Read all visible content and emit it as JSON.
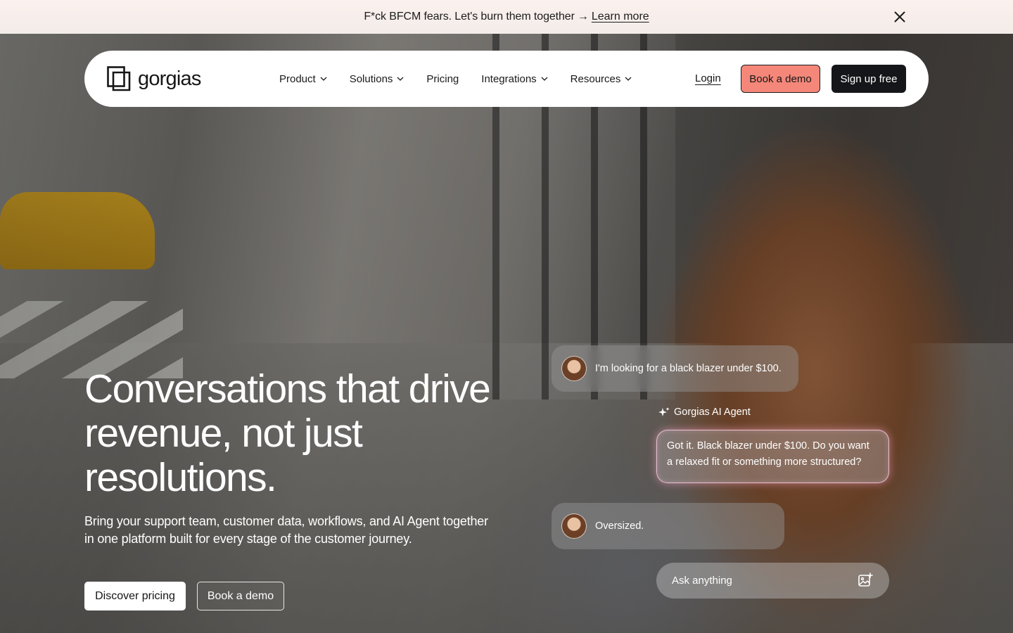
{
  "announcement": {
    "text": "F*ck BFCM fears. Let's burn them together",
    "arrow": "→",
    "link_label": "Learn more"
  },
  "nav": {
    "logo_text": "gorgias",
    "items": [
      {
        "label": "Product",
        "has_dropdown": true
      },
      {
        "label": "Solutions",
        "has_dropdown": true
      },
      {
        "label": "Pricing",
        "has_dropdown": false
      },
      {
        "label": "Integrations",
        "has_dropdown": true
      },
      {
        "label": "Resources",
        "has_dropdown": true
      }
    ],
    "login_label": "Login",
    "book_demo_label": "Book a demo",
    "signup_label": "Sign up free"
  },
  "hero": {
    "title": "Conversations that drive revenue, not just resolutions.",
    "subtitle": "Bring your support team, customer data, workflows, and AI Agent together in one platform built for every stage of the customer journey.",
    "primary_cta": "Discover pricing",
    "secondary_cta": "Book a demo"
  },
  "chat": {
    "user_message_1": "I'm looking for a black blazer under $100.",
    "agent_name": "Gorgias AI Agent",
    "agent_message": "Got it. Black blazer under $100. Do you want a relaxed fit or something more structured?",
    "user_message_2": "Oversized.",
    "input_placeholder": "Ask anything"
  },
  "colors": {
    "accent_coral": "#f4877a",
    "dark_button": "#151619",
    "announcement_bg": "#fbf1ee"
  }
}
